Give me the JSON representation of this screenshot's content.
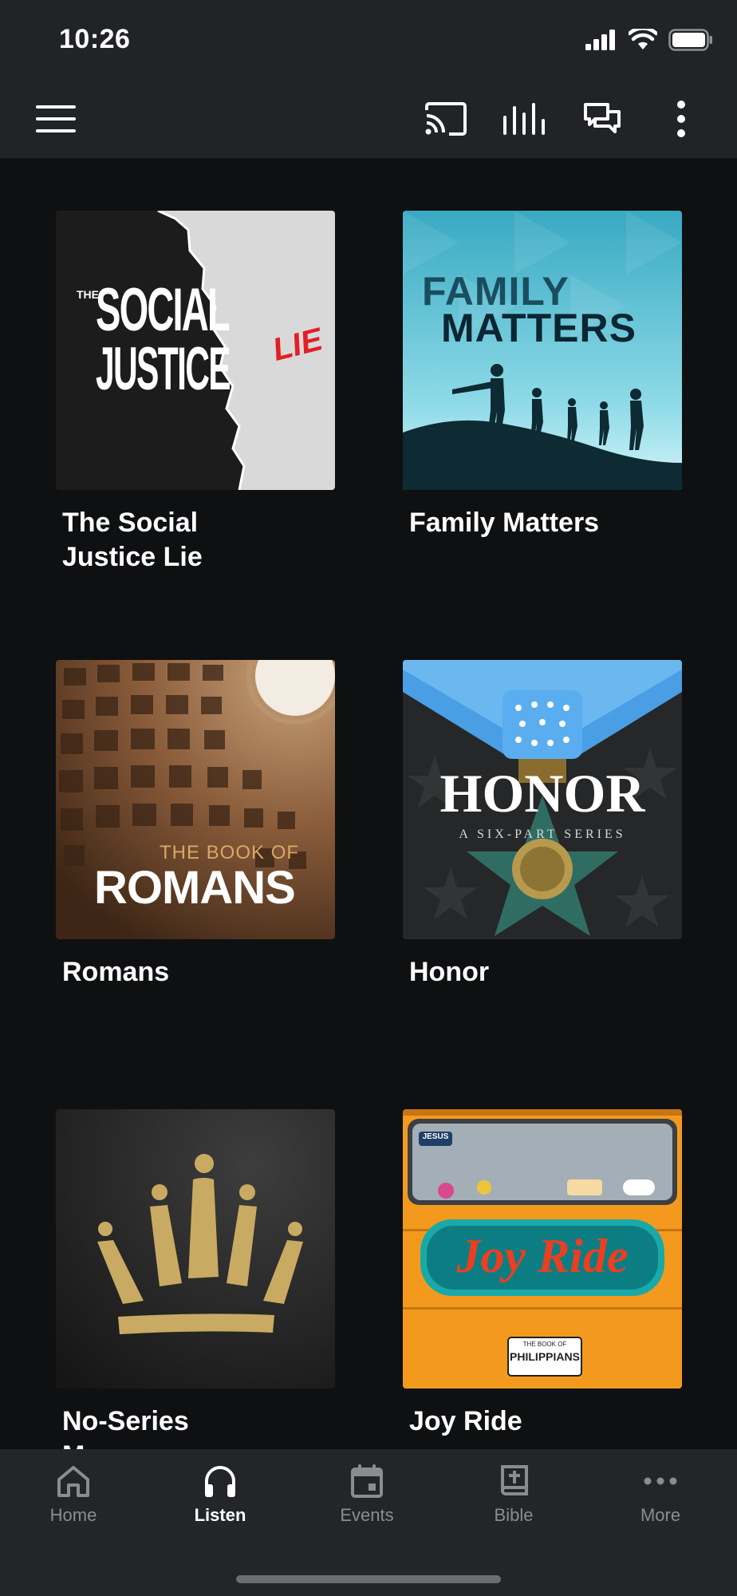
{
  "status_bar": {
    "time": "10:26"
  },
  "top_nav": {
    "icons": [
      "menu-icon",
      "cast-icon",
      "equalizer-icon",
      "chat-icon",
      "more-vertical-icon"
    ]
  },
  "series": [
    {
      "title": "The Social Justice Lie",
      "art_text": {
        "the": "THE",
        "line1": "SOCIAL",
        "line2": "JUSTICE",
        "accent": "LIE"
      }
    },
    {
      "title": "Family Matters",
      "art_text": {
        "line1": "FAMILY",
        "line2": "MATTERS"
      }
    },
    {
      "title": "Romans",
      "art_text": {
        "line1": "THE BOOK OF",
        "line2": "ROMANS"
      }
    },
    {
      "title": "Honor",
      "art_text": {
        "line1": "HONOR",
        "line2": "A SIX-PART SERIES"
      }
    },
    {
      "title": "No-Series Messages",
      "art_text": {}
    },
    {
      "title": "Joy Ride",
      "art_text": {
        "line1": "Joy Ride",
        "plate_top": "THE BOOK OF",
        "plate": "PHILIPPIANS",
        "sticker": "JESUS"
      }
    }
  ],
  "tabs": [
    {
      "label": "Home",
      "icon": "home-icon",
      "active": false
    },
    {
      "label": "Listen",
      "icon": "headphones-icon",
      "active": true
    },
    {
      "label": "Events",
      "icon": "calendar-icon",
      "active": false
    },
    {
      "label": "Bible",
      "icon": "bible-icon",
      "active": false
    },
    {
      "label": "More",
      "icon": "more-horizontal-icon",
      "active": false
    }
  ],
  "colors": {
    "bar_bg": "#212327",
    "content_bg": "#0f1012",
    "tab_bar_bg": "#232529",
    "inactive": "#8a8c90",
    "active": "#ffffff"
  }
}
